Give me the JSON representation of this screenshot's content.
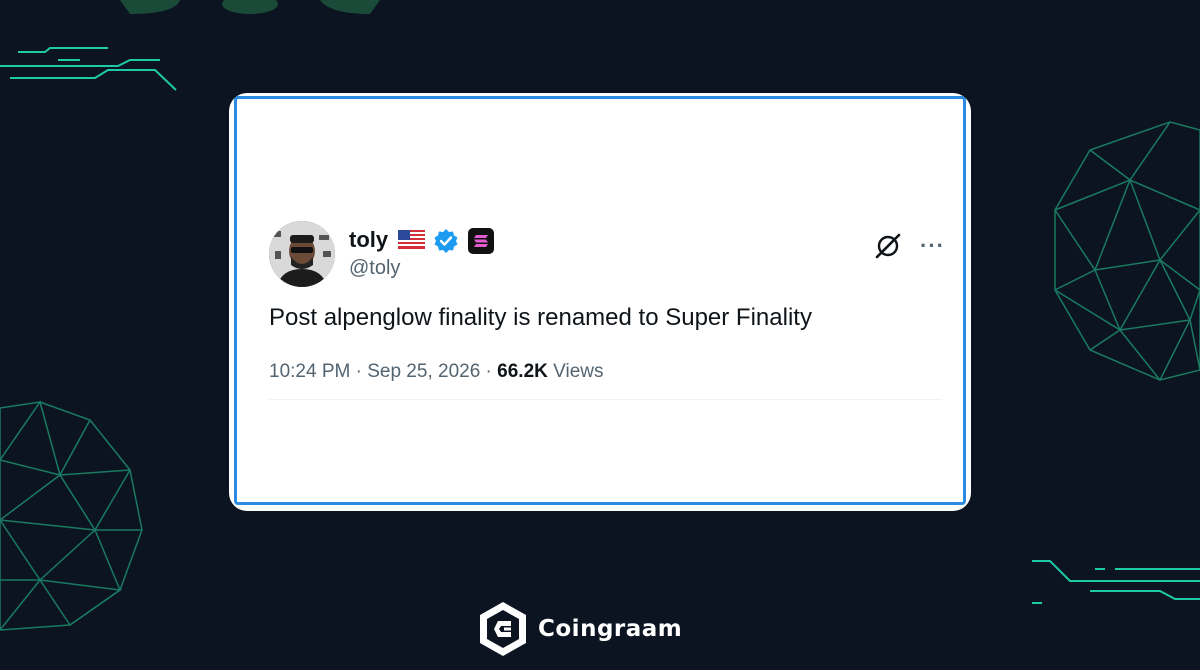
{
  "tweet": {
    "display_name": "toly",
    "handle": "@toly",
    "text": "Post alpenglow finality is renamed to Super Finality",
    "time": "10:24 PM",
    "separator": "·",
    "date": "Sep 25, 2026",
    "views_count": "66.2K",
    "views_label": "Views",
    "more_label": "···"
  },
  "brand": {
    "name": "Coingraam"
  },
  "colors": {
    "background": "#0b1420",
    "accent_teal": "#1ec9a6",
    "card_border": "#2b8be0",
    "verified": "#1d9bf0"
  },
  "icons": {
    "flag": "us-flag-icon",
    "verified": "verified-badge-icon",
    "affiliate": "solana-badge-icon",
    "grok": "grok-icon",
    "more": "more-options-icon",
    "logo": "coingraam-logo-icon"
  }
}
